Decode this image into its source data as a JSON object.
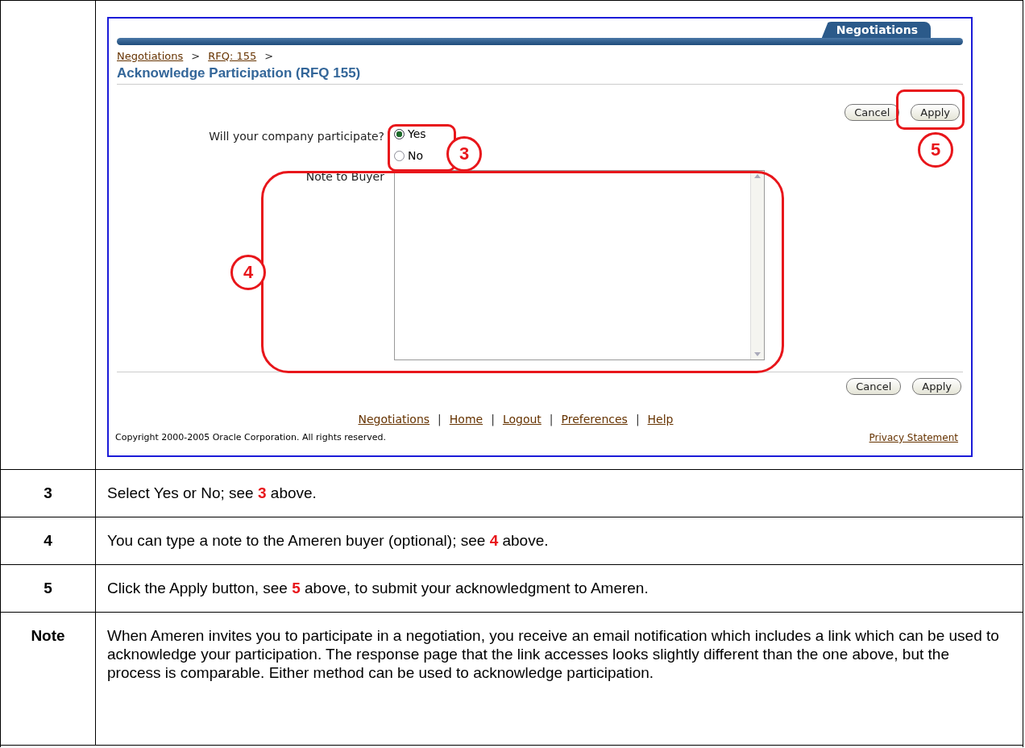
{
  "screenshot": {
    "tab": {
      "label": "Negotiations",
      "selected": true
    },
    "breadcrumbs": [
      "Negotiations",
      "RFQ: 155"
    ],
    "breadcrumb_separator": ">",
    "title": "Acknowledge Participation (RFQ 155)",
    "top_buttons": [
      "Cancel",
      "Apply"
    ],
    "question": "Will your company participate?",
    "options": [
      {
        "label": "Yes",
        "selected": true
      },
      {
        "label": "No",
        "selected": false
      }
    ],
    "note_label": "Note to Buyer",
    "bottom_buttons": [
      "Cancel",
      "Apply"
    ],
    "footer_links": [
      "Negotiations",
      "Home",
      "Logout",
      "Preferences",
      "Help"
    ],
    "footer_separator": "|",
    "copyright": "Copyright 2000-2005 Oracle Corporation. All rights reserved.",
    "privacy_link": "Privacy Statement",
    "callouts": [
      {
        "number": "3",
        "kind": "options"
      },
      {
        "number": "4",
        "kind": "note"
      },
      {
        "number": "5",
        "kind": "apply"
      }
    ]
  },
  "steps": [
    {
      "label": "3",
      "text": "Select Yes or No; see **3** above."
    },
    {
      "label": "4",
      "text": "You can type a note to the Ameren buyer (optional); see **4** above."
    },
    {
      "label": "5",
      "text": "Click the Apply button, see **5** above, to submit your acknowledgment to Ameren."
    },
    {
      "label": "Note",
      "text": "When Ameren invites you to participate in a negotiation, you receive an email notification which includes a link which can be used to acknowledge your participation. The response page that the link accesses looks slightly different than the one above, but the process is comparable. Either method can be used to acknowledge participation."
    }
  ]
}
